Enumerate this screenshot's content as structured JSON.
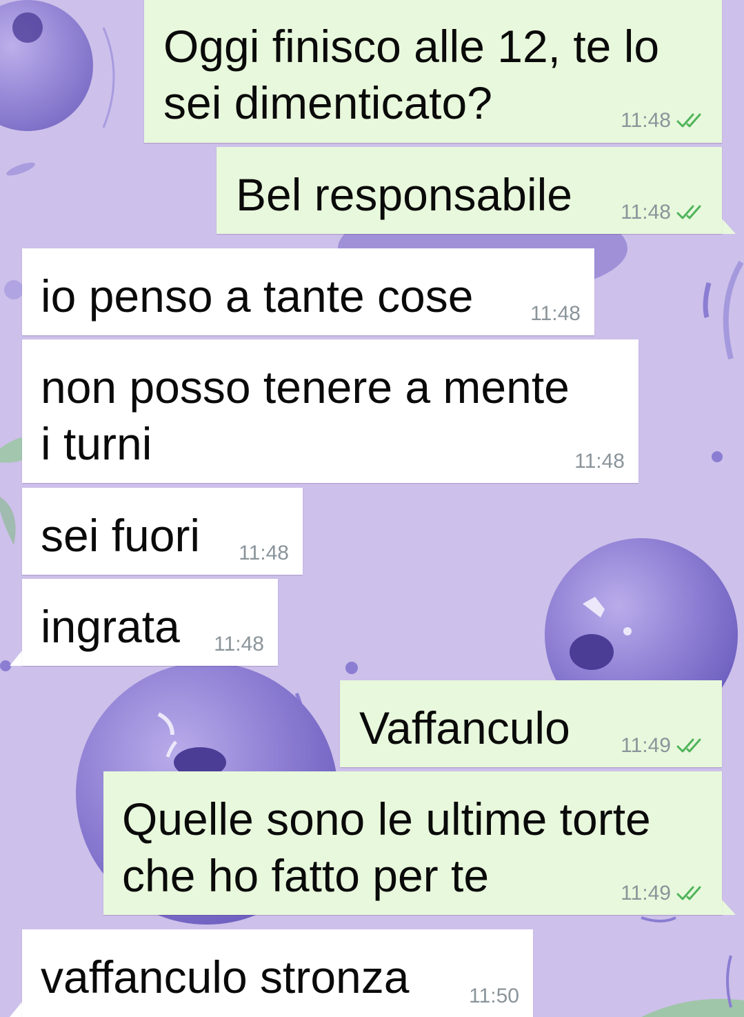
{
  "chat": {
    "messages": [
      {
        "direction": "outgoing",
        "lines": [
          "Oggi finisco alle 12, te lo",
          "sei dimenticato?"
        ],
        "time": "11:48",
        "status": "read"
      },
      {
        "direction": "outgoing",
        "lines": [
          "Bel responsabile"
        ],
        "time": "11:48",
        "status": "read"
      },
      {
        "direction": "incoming",
        "lines": [
          "io penso a tante cose"
        ],
        "time": "11:48"
      },
      {
        "direction": "incoming",
        "lines": [
          "non posso tenere a mente",
          "i turni"
        ],
        "time": "11:48"
      },
      {
        "direction": "incoming",
        "lines": [
          "sei fuori"
        ],
        "time": "11:48"
      },
      {
        "direction": "incoming",
        "lines": [
          "ingrata"
        ],
        "time": "11:48"
      },
      {
        "direction": "outgoing",
        "lines": [
          "Vaffanculo"
        ],
        "time": "11:49",
        "status": "read"
      },
      {
        "direction": "outgoing",
        "lines": [
          "Quelle sono le ultime torte",
          "che ho fatto per te"
        ],
        "time": "11:49",
        "status": "read"
      },
      {
        "direction": "incoming",
        "lines": [
          "vaffanculo stronza"
        ],
        "time": "11:50"
      }
    ]
  },
  "theme": {
    "outgoing_bubble": "#e8f8dc",
    "incoming_bubble": "#ffffff",
    "wallpaper": "#cdc0ea",
    "read_tick": "#4fb45a",
    "timestamp": "#8a949a",
    "wallpaper_motif": "watercolor blueberries"
  }
}
